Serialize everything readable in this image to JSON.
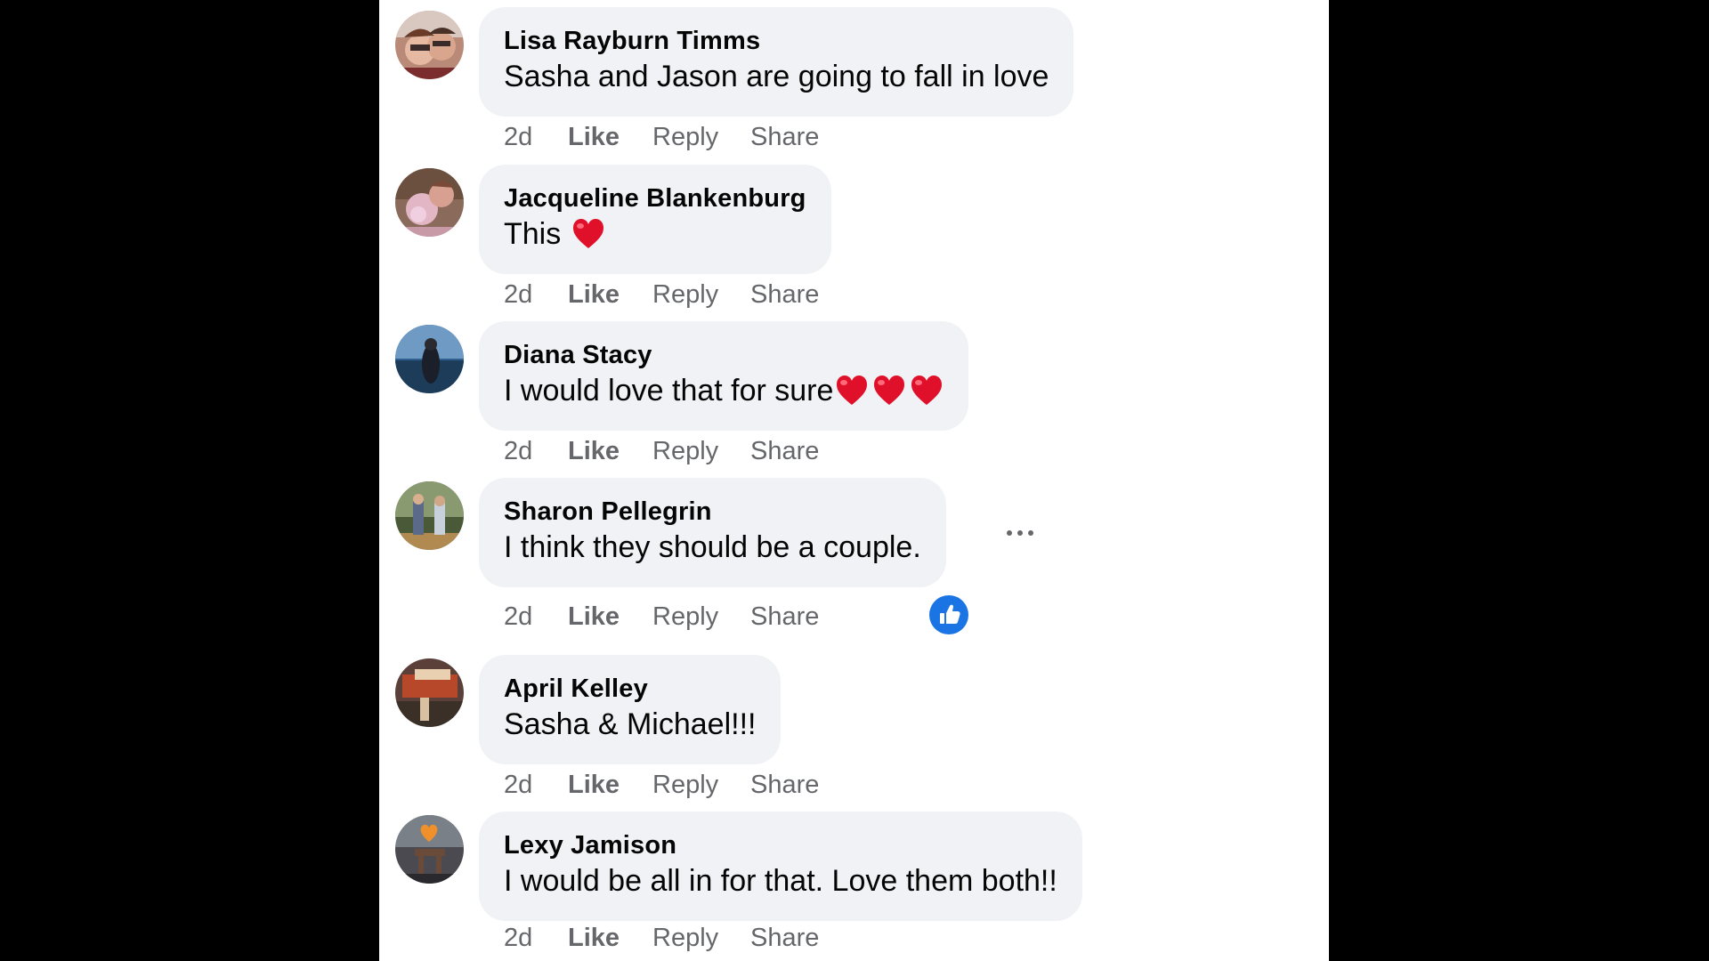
{
  "comments": [
    {
      "author": "Lisa Rayburn Timms",
      "text": "Sasha and Jason are going to fall in love",
      "hearts": 0,
      "time": "2d",
      "like": "Like",
      "reply": "Reply",
      "share": "Share"
    },
    {
      "author": "Jacqueline Blankenburg",
      "text": "This",
      "hearts": 1,
      "time": "2d",
      "like": "Like",
      "reply": "Reply",
      "share": "Share"
    },
    {
      "author": "Diana Stacy",
      "text": "I would love that for sure",
      "hearts": 3,
      "time": "2d",
      "like": "Like",
      "reply": "Reply",
      "share": "Share"
    },
    {
      "author": "Sharon Pellegrin",
      "text": "I think they should be a couple.",
      "hearts": 0,
      "time": "2d",
      "like": "Like",
      "reply": "Reply",
      "share": "Share",
      "reaction_icon": "thumbs-up-icon"
    },
    {
      "author": "April Kelley",
      "text": "Sasha & Michael!!!",
      "hearts": 0,
      "time": "2d",
      "like": "Like",
      "reply": "Reply",
      "share": "Share"
    },
    {
      "author": "Lexy Jamison",
      "text": "I would be all in for that. Love them both!!",
      "hearts": 0,
      "time": "2d",
      "like": "Like",
      "reply": "Reply",
      "share": "Share"
    }
  ],
  "icons": {
    "heart": "heart-emoji-icon",
    "more": "more-options-icon",
    "reaction": "thumbs-up-icon"
  },
  "colors": {
    "bubble_bg": "#f0f2f5",
    "meta_text": "#65676b",
    "like_blue": "#1b74e4",
    "heart_red": "#e0102a"
  }
}
